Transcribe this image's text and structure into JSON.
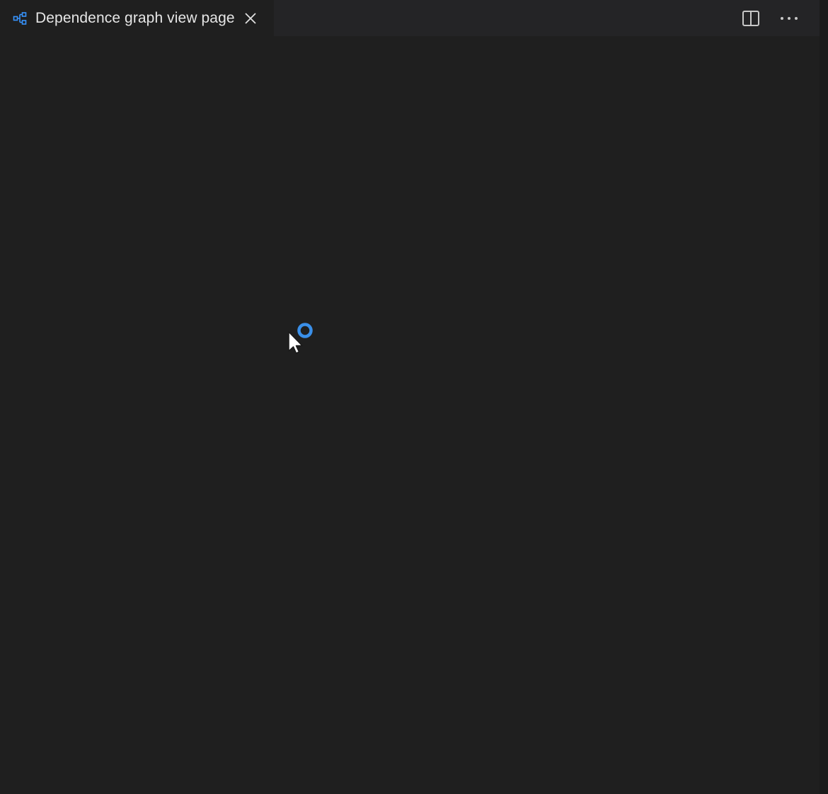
{
  "tab": {
    "label": "Dependence graph view page",
    "icon": "graph-view-icon",
    "close_icon": "close-icon"
  },
  "actions": {
    "split_editor_icon": "split-editor-icon",
    "more_actions_icon": "more-actions-icon"
  },
  "content": {
    "state": "loading",
    "cursor_icon": "busy-cursor-icon"
  },
  "colors": {
    "editor_background": "#1f1f1f",
    "tab_bar_background": "#242426",
    "accent": "#3794ff",
    "text": "#e6e6e6"
  }
}
